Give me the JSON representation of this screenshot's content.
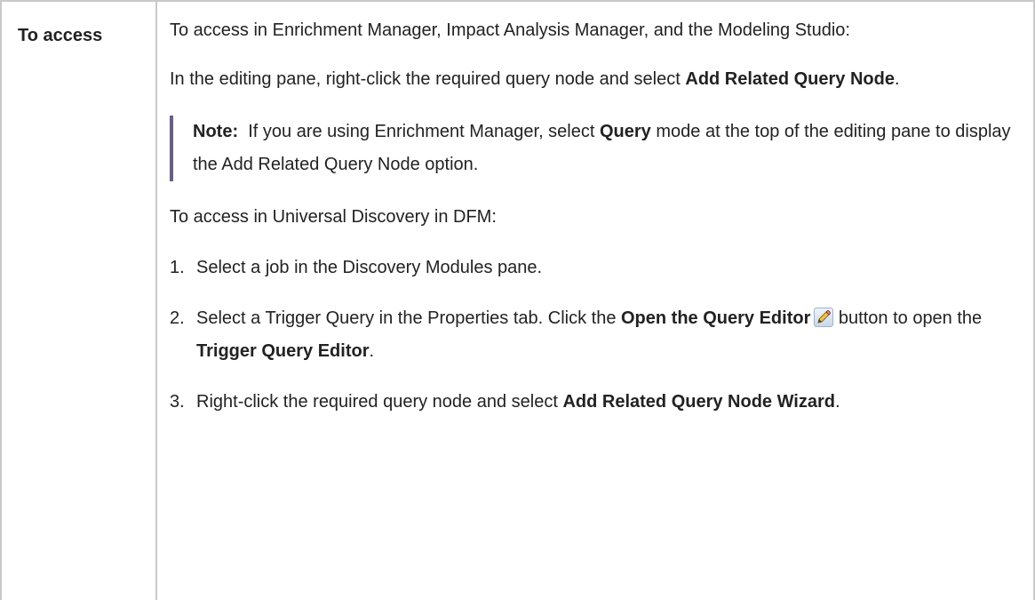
{
  "table": {
    "label": "To access",
    "intro": "To access in Enrichment Manager, Impact Analysis Manager, and the Modeling Studio:",
    "editing": {
      "pre": "In the editing pane, right-click the required query node and select ",
      "bold": "Add Related Query Node",
      "post": "."
    },
    "note": {
      "label": "Note:",
      "pre": "  If you are using Enrichment Manager, select ",
      "bold": "Query",
      "post": " mode at the top of the editing pane to display the Add Related Query Node option."
    },
    "dfm_intro": "To access in Universal Discovery in DFM:",
    "steps": [
      {
        "num": "1.",
        "text": "Select a job in the Discovery Modules pane."
      },
      {
        "num": "2.",
        "pre": "Select a Trigger Query in the Properties tab. Click the ",
        "bold1": "Open the Query Editor",
        "mid": " button to open the ",
        "bold2": "Trigger Query Editor",
        "post": ".",
        "icon": "pencil-edit-icon"
      },
      {
        "num": "3.",
        "pre": "Right-click the required query node and select ",
        "bold": "Add Related Query Node Wizard",
        "post": "."
      }
    ]
  },
  "colors": {
    "border": "#c9c9c9",
    "note_bar": "#6b5d83",
    "text": "#222222"
  }
}
